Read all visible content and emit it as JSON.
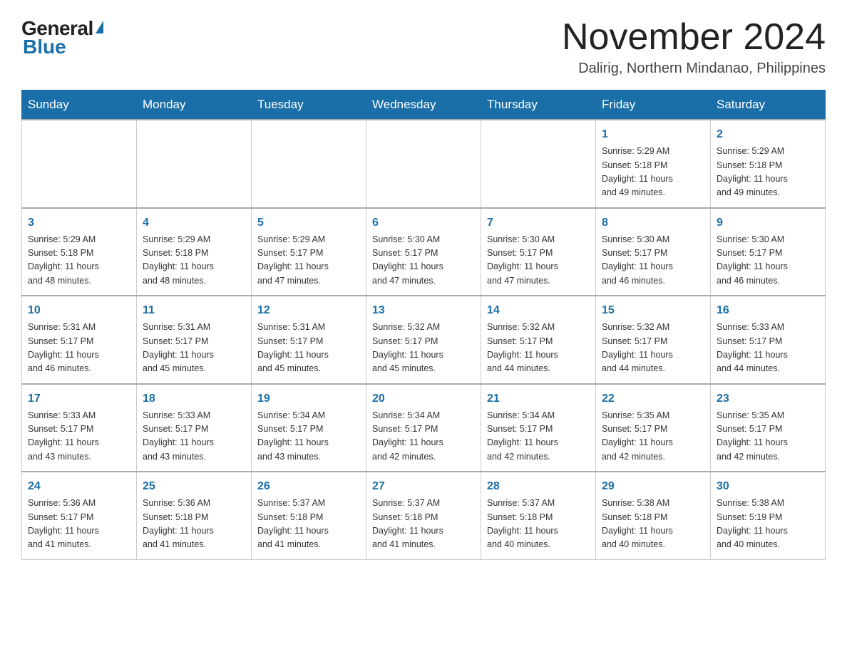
{
  "logo": {
    "general": "General",
    "triangle": "▶",
    "blue": "Blue"
  },
  "title": "November 2024",
  "subtitle": "Dalirig, Northern Mindanao, Philippines",
  "days_of_week": [
    "Sunday",
    "Monday",
    "Tuesday",
    "Wednesday",
    "Thursday",
    "Friday",
    "Saturday"
  ],
  "weeks": [
    [
      {
        "day": "",
        "info": ""
      },
      {
        "day": "",
        "info": ""
      },
      {
        "day": "",
        "info": ""
      },
      {
        "day": "",
        "info": ""
      },
      {
        "day": "",
        "info": ""
      },
      {
        "day": "1",
        "info": "Sunrise: 5:29 AM\nSunset: 5:18 PM\nDaylight: 11 hours\nand 49 minutes."
      },
      {
        "day": "2",
        "info": "Sunrise: 5:29 AM\nSunset: 5:18 PM\nDaylight: 11 hours\nand 49 minutes."
      }
    ],
    [
      {
        "day": "3",
        "info": "Sunrise: 5:29 AM\nSunset: 5:18 PM\nDaylight: 11 hours\nand 48 minutes."
      },
      {
        "day": "4",
        "info": "Sunrise: 5:29 AM\nSunset: 5:18 PM\nDaylight: 11 hours\nand 48 minutes."
      },
      {
        "day": "5",
        "info": "Sunrise: 5:29 AM\nSunset: 5:17 PM\nDaylight: 11 hours\nand 47 minutes."
      },
      {
        "day": "6",
        "info": "Sunrise: 5:30 AM\nSunset: 5:17 PM\nDaylight: 11 hours\nand 47 minutes."
      },
      {
        "day": "7",
        "info": "Sunrise: 5:30 AM\nSunset: 5:17 PM\nDaylight: 11 hours\nand 47 minutes."
      },
      {
        "day": "8",
        "info": "Sunrise: 5:30 AM\nSunset: 5:17 PM\nDaylight: 11 hours\nand 46 minutes."
      },
      {
        "day": "9",
        "info": "Sunrise: 5:30 AM\nSunset: 5:17 PM\nDaylight: 11 hours\nand 46 minutes."
      }
    ],
    [
      {
        "day": "10",
        "info": "Sunrise: 5:31 AM\nSunset: 5:17 PM\nDaylight: 11 hours\nand 46 minutes."
      },
      {
        "day": "11",
        "info": "Sunrise: 5:31 AM\nSunset: 5:17 PM\nDaylight: 11 hours\nand 45 minutes."
      },
      {
        "day": "12",
        "info": "Sunrise: 5:31 AM\nSunset: 5:17 PM\nDaylight: 11 hours\nand 45 minutes."
      },
      {
        "day": "13",
        "info": "Sunrise: 5:32 AM\nSunset: 5:17 PM\nDaylight: 11 hours\nand 45 minutes."
      },
      {
        "day": "14",
        "info": "Sunrise: 5:32 AM\nSunset: 5:17 PM\nDaylight: 11 hours\nand 44 minutes."
      },
      {
        "day": "15",
        "info": "Sunrise: 5:32 AM\nSunset: 5:17 PM\nDaylight: 11 hours\nand 44 minutes."
      },
      {
        "day": "16",
        "info": "Sunrise: 5:33 AM\nSunset: 5:17 PM\nDaylight: 11 hours\nand 44 minutes."
      }
    ],
    [
      {
        "day": "17",
        "info": "Sunrise: 5:33 AM\nSunset: 5:17 PM\nDaylight: 11 hours\nand 43 minutes."
      },
      {
        "day": "18",
        "info": "Sunrise: 5:33 AM\nSunset: 5:17 PM\nDaylight: 11 hours\nand 43 minutes."
      },
      {
        "day": "19",
        "info": "Sunrise: 5:34 AM\nSunset: 5:17 PM\nDaylight: 11 hours\nand 43 minutes."
      },
      {
        "day": "20",
        "info": "Sunrise: 5:34 AM\nSunset: 5:17 PM\nDaylight: 11 hours\nand 42 minutes."
      },
      {
        "day": "21",
        "info": "Sunrise: 5:34 AM\nSunset: 5:17 PM\nDaylight: 11 hours\nand 42 minutes."
      },
      {
        "day": "22",
        "info": "Sunrise: 5:35 AM\nSunset: 5:17 PM\nDaylight: 11 hours\nand 42 minutes."
      },
      {
        "day": "23",
        "info": "Sunrise: 5:35 AM\nSunset: 5:17 PM\nDaylight: 11 hours\nand 42 minutes."
      }
    ],
    [
      {
        "day": "24",
        "info": "Sunrise: 5:36 AM\nSunset: 5:17 PM\nDaylight: 11 hours\nand 41 minutes."
      },
      {
        "day": "25",
        "info": "Sunrise: 5:36 AM\nSunset: 5:18 PM\nDaylight: 11 hours\nand 41 minutes."
      },
      {
        "day": "26",
        "info": "Sunrise: 5:37 AM\nSunset: 5:18 PM\nDaylight: 11 hours\nand 41 minutes."
      },
      {
        "day": "27",
        "info": "Sunrise: 5:37 AM\nSunset: 5:18 PM\nDaylight: 11 hours\nand 41 minutes."
      },
      {
        "day": "28",
        "info": "Sunrise: 5:37 AM\nSunset: 5:18 PM\nDaylight: 11 hours\nand 40 minutes."
      },
      {
        "day": "29",
        "info": "Sunrise: 5:38 AM\nSunset: 5:18 PM\nDaylight: 11 hours\nand 40 minutes."
      },
      {
        "day": "30",
        "info": "Sunrise: 5:38 AM\nSunset: 5:19 PM\nDaylight: 11 hours\nand 40 minutes."
      }
    ]
  ]
}
